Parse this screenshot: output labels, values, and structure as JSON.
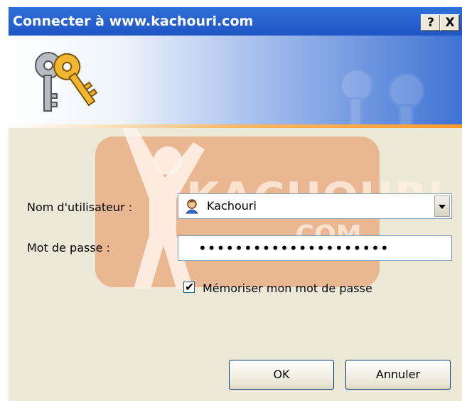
{
  "window": {
    "title": "Connecter à www.kachouri.com",
    "help_label": "?",
    "close_label": "X"
  },
  "watermark": {
    "brand": "KACHOURI",
    "domain": ".COM"
  },
  "form": {
    "username_label": "Nom d'utilisateur :",
    "username_value": "Kachouri",
    "password_label": "Mot de passe :",
    "password_mask": "•••••••••••••••••••••",
    "remember_label": "Mémoriser mon mot de passe",
    "remember_checked": true
  },
  "buttons": {
    "ok_label": "OK",
    "cancel_label": "Annuler"
  },
  "colors": {
    "titlebar": "#2466d0",
    "dialog_bg": "#ece9d8",
    "watermark": "#e87a40",
    "banner_accent": "#ff9a2a"
  },
  "icons": {
    "banner": "keys-icon",
    "user": "user-icon"
  }
}
